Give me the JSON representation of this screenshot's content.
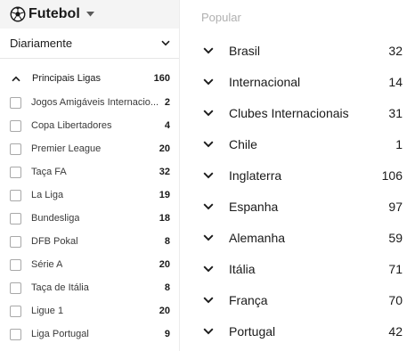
{
  "sport": {
    "name": "Futebol",
    "icon": "soccer-ball-icon"
  },
  "period": {
    "label": "Diariamente"
  },
  "group": {
    "label": "Principais Ligas",
    "count": "160"
  },
  "leagues": [
    {
      "name": "Jogos Amigáveis Internacio...",
      "count": "2"
    },
    {
      "name": "Copa Libertadores",
      "count": "4"
    },
    {
      "name": "Premier League",
      "count": "20"
    },
    {
      "name": "Taça FA",
      "count": "32"
    },
    {
      "name": "La Liga",
      "count": "19"
    },
    {
      "name": "Bundesliga",
      "count": "18"
    },
    {
      "name": "DFB Pokal",
      "count": "8"
    },
    {
      "name": "Série A",
      "count": "20"
    },
    {
      "name": "Taça de Itália",
      "count": "8"
    },
    {
      "name": "Ligue 1",
      "count": "20"
    },
    {
      "name": "Liga Portugal",
      "count": "9"
    }
  ],
  "popular": {
    "label": "Popular",
    "countries": [
      {
        "name": "Brasil",
        "count": "32"
      },
      {
        "name": "Internacional",
        "count": "14"
      },
      {
        "name": "Clubes Internacionais",
        "count": "31"
      },
      {
        "name": "Chile",
        "count": "1"
      },
      {
        "name": "Inglaterra",
        "count": "106"
      },
      {
        "name": "Espanha",
        "count": "97"
      },
      {
        "name": "Alemanha",
        "count": "59"
      },
      {
        "name": "Itália",
        "count": "71"
      },
      {
        "name": "França",
        "count": "70"
      },
      {
        "name": "Portugal",
        "count": "42"
      }
    ]
  },
  "colors": {
    "header_bg": "#f4f4f4",
    "text": "#1a1a1a",
    "muted": "#b0b0b0",
    "checkbox_border": "#a8a8a8"
  }
}
